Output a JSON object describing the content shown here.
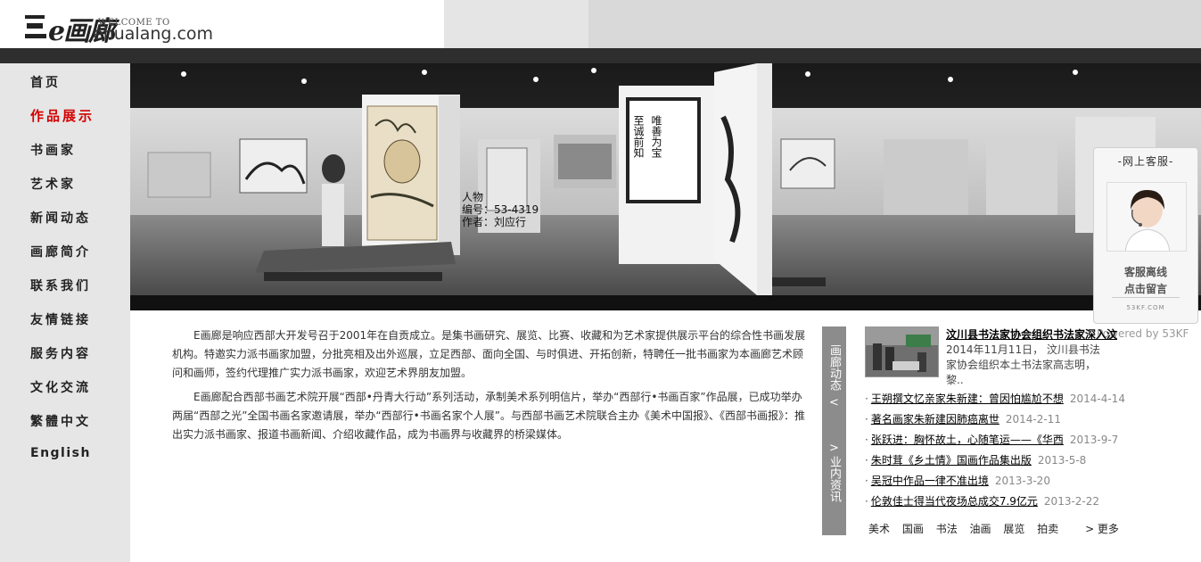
{
  "header": {
    "logo_cn": "e画廊",
    "welcome": "WELCOME TO",
    "domain": "ehualang.com"
  },
  "nav": [
    {
      "label": "首页",
      "active": false
    },
    {
      "label": "作品展示",
      "active": true
    },
    {
      "label": "书画家",
      "active": false
    },
    {
      "label": "艺术家",
      "active": false
    },
    {
      "label": "新闻动态",
      "active": false
    },
    {
      "label": "画廊简介",
      "active": false
    },
    {
      "label": "联系我们",
      "active": false
    },
    {
      "label": "友情链接",
      "active": false
    },
    {
      "label": "服务内容",
      "active": false
    },
    {
      "label": "文化交流",
      "active": false
    },
    {
      "label": "繁體中文",
      "active": false
    },
    {
      "label": "English",
      "active": false
    }
  ],
  "banner": {
    "caption_category": "人物",
    "caption_number": "编号：53-4319",
    "caption_author": "作者：刘应行",
    "calligraphy": [
      "至诚前知",
      "唯善为宝"
    ]
  },
  "intro": {
    "para1": "E画廊是响应西部大开发号召于2001年在自贡成立。是集书画研究、展览、比赛、收藏和为艺术家提供展示平台的综合性书画发展机构。特邀实力派书画家加盟，分批亮相及出外巡展，立足西部、面向全国、与时俱进、开拓创新，特聘任一批书画家为本画廊艺术顾问和画师，签约代理推广实力派书画家，欢迎艺术界朋友加盟。",
    "para2": "E画廊配合西部书画艺术院开展“西部•丹青大行动”系列活动，承制美术系列明信片，举办“西部行•书画百家”作品展，已成功举办两届“西部之光”全国书画名家邀请展，举办“西部行•书画名家个人展”。与西部书画艺术院联合主办《美术中国报》、《西部书画报》：推出实力派书画家、报道书画新闻、介绍收藏作品，成为书画界与收藏界的桥梁媒体。"
  },
  "tabs": {
    "tab1": "画廊动态",
    "tab2": "业内资讯"
  },
  "chat": {
    "title": "-网上客服-",
    "status": "客服离线",
    "message": "点击留言",
    "brand": "53KF.COM",
    "powered": "Powered by 53KF"
  },
  "news": {
    "featured_title": "汶川县书法家协会组织书法家深入汶",
    "featured_summary": "2014年11月11日， 汶川县书法家协会组织本土书法家高志明，黎..",
    "items": [
      {
        "title": "王朔撰文忆亲家朱新建：曾因怕尴尬不想",
        "date": "2014-4-14"
      },
      {
        "title": "著名画家朱新建因肺癌离世",
        "date": "2014-2-11"
      },
      {
        "title": "张跃进：胸怀故土，心随笔运——《华西",
        "date": "2013-9-7"
      },
      {
        "title": "朱时茸《乡土情》国画作品集出版",
        "date": "2013-5-8"
      },
      {
        "title": "吴冠中作品一律不准出境",
        "date": "2013-3-20"
      },
      {
        "title": "伦敦佳士得当代夜场总成交7.9亿元",
        "date": "2013-2-22"
      }
    ],
    "tags": [
      "美术",
      "国画",
      "书法",
      "油画",
      "展览",
      "拍卖"
    ],
    "more": "> 更多"
  }
}
